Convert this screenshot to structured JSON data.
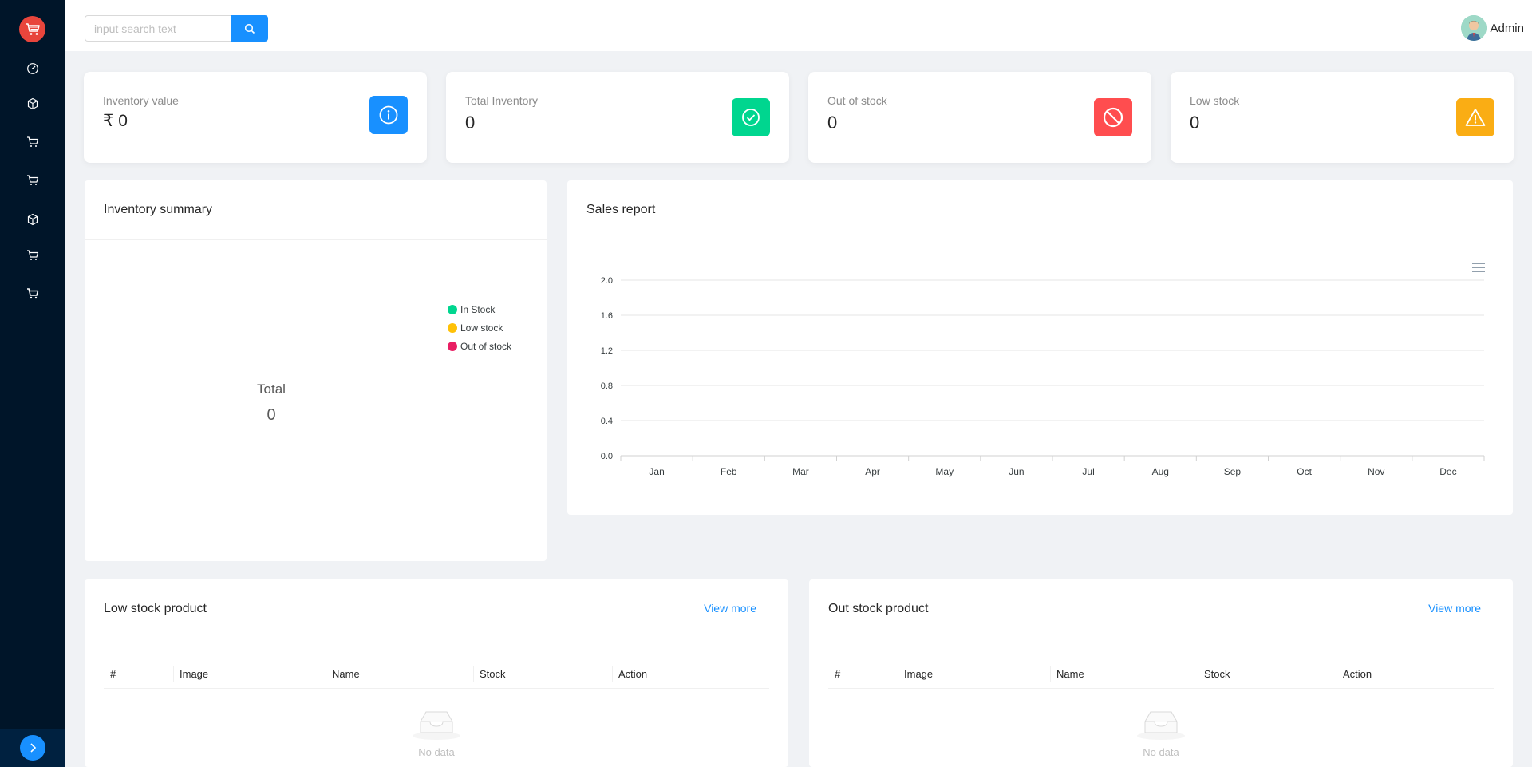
{
  "header": {
    "search_placeholder": "input search text",
    "user_name": "Admin"
  },
  "sidebar": {
    "items": [
      {
        "icon": "dashboard-icon"
      },
      {
        "icon": "cube-icon"
      },
      {
        "icon": "cart-icon"
      },
      {
        "icon": "cart-icon"
      },
      {
        "icon": "cube-icon"
      },
      {
        "icon": "cart-icon"
      },
      {
        "icon": "cart-icon"
      }
    ]
  },
  "stats": [
    {
      "label": "Inventory value",
      "value": "₹ 0",
      "icon": "info-icon",
      "color": "#1890ff"
    },
    {
      "label": "Total Inventory",
      "value": "0",
      "icon": "check-circle-icon",
      "color": "#00d68f"
    },
    {
      "label": "Out of stock",
      "value": "0",
      "icon": "stop-icon",
      "color": "#ff4d4f"
    },
    {
      "label": "Low stock",
      "value": "0",
      "icon": "warning-icon",
      "color": "#faad14"
    }
  ],
  "inventory_summary": {
    "title": "Inventory summary",
    "total_label": "Total",
    "total_value": "0",
    "legend": [
      {
        "name": "In Stock",
        "color": "#00d68f"
      },
      {
        "name": "Low stock",
        "color": "#ffc107"
      },
      {
        "name": "Out of stock",
        "color": "#e91e63"
      }
    ]
  },
  "sales_report": {
    "title": "Sales report"
  },
  "chart_data": {
    "type": "line",
    "title": "",
    "categories": [
      "Jan",
      "Feb",
      "Mar",
      "Apr",
      "May",
      "Jun",
      "Jul",
      "Aug",
      "Sep",
      "Oct",
      "Nov",
      "Dec"
    ],
    "series": [],
    "y_ticks": [
      "2.0",
      "1.6",
      "1.2",
      "0.8",
      "0.4",
      "0.0"
    ],
    "ylim": [
      0,
      2
    ],
    "grid": true,
    "xlabel": "",
    "ylabel": ""
  },
  "low_stock": {
    "title": "Low stock product",
    "view_more": "View more",
    "columns": [
      "#",
      "Image",
      "Name",
      "Stock",
      "Action"
    ],
    "empty_text": "No data"
  },
  "out_stock": {
    "title": "Out stock product",
    "view_more": "View more",
    "columns": [
      "#",
      "Image",
      "Name",
      "Stock",
      "Action"
    ],
    "empty_text": "No data"
  }
}
